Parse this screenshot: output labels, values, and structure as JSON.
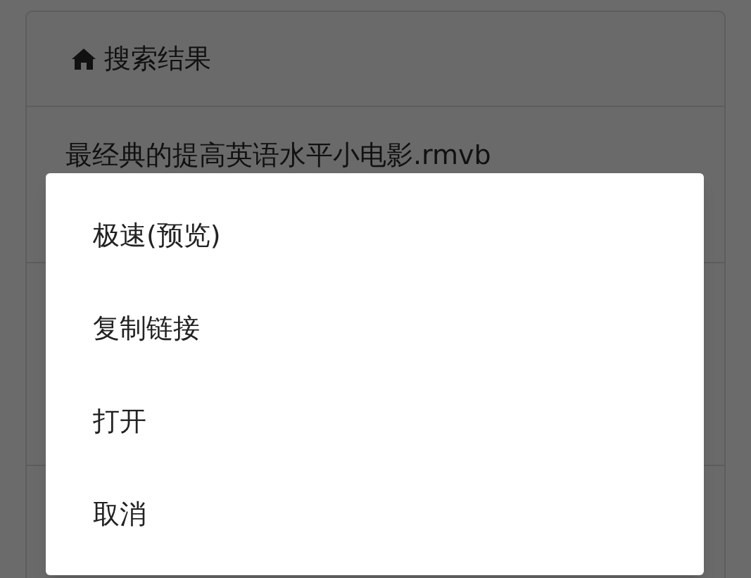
{
  "panel": {
    "title": "搜索结果",
    "items": [
      {
        "name": "最经典的提高英语水平小电影.rmvb"
      }
    ]
  },
  "dialog": {
    "options": [
      {
        "label": "极速(预览)"
      },
      {
        "label": "复制链接"
      },
      {
        "label": "打开"
      },
      {
        "label": "取消"
      }
    ]
  }
}
